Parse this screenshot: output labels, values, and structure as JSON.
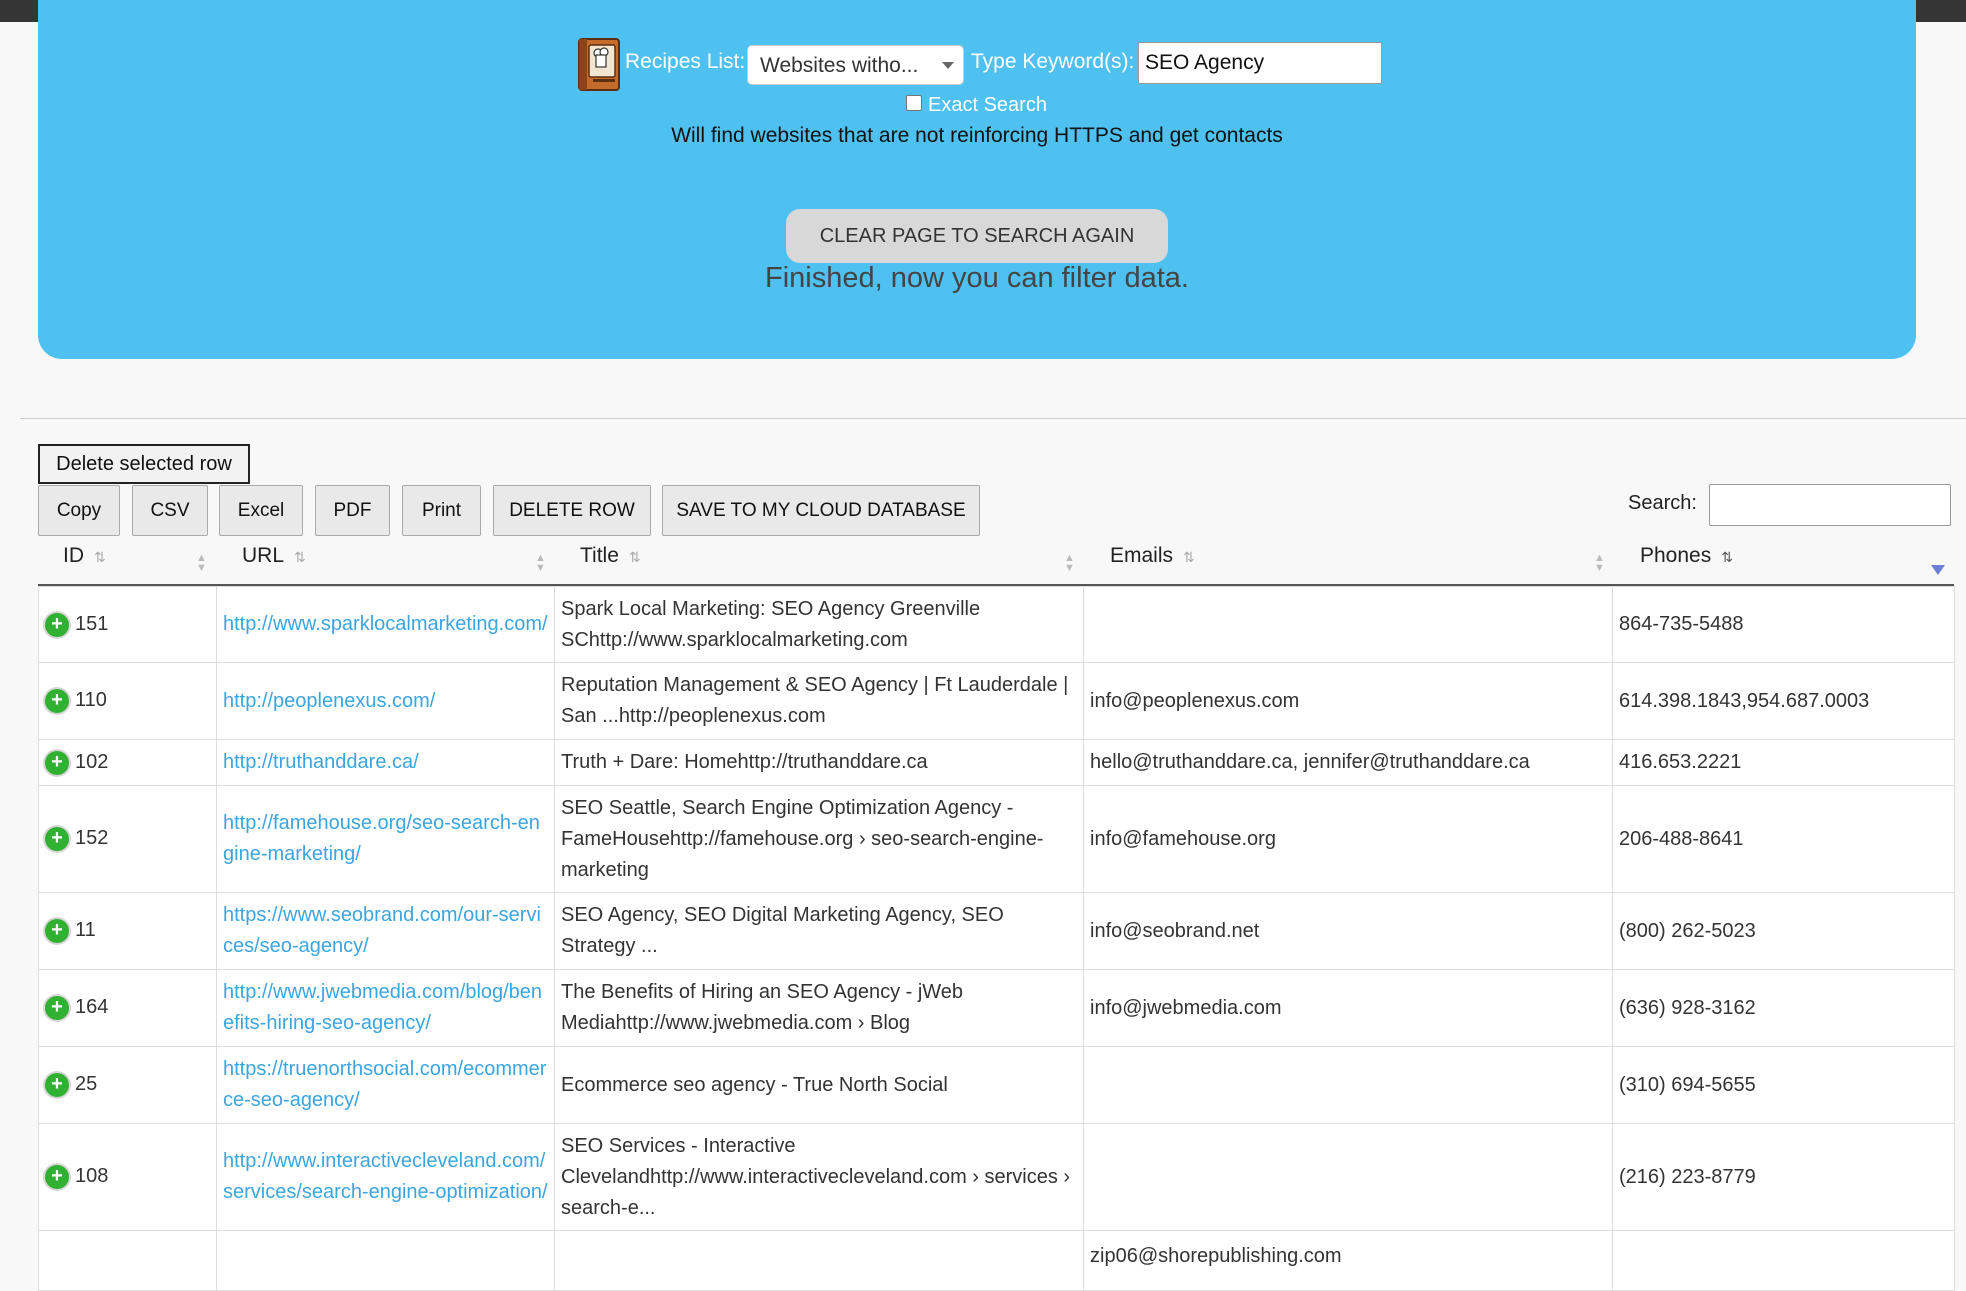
{
  "form": {
    "recipes_label": "Recipes List:",
    "recipe_selected": "Websites witho...",
    "keyword_label": "Type Keyword(s):",
    "keyword_value": "SEO Agency",
    "exact_search_label": "Exact Search",
    "description": "Will find websites that are not reinforcing HTTPS and get contacts",
    "clear_button": "CLEAR PAGE TO SEARCH AGAIN",
    "status": "Finished, now you can filter data."
  },
  "toolbar": {
    "delete_selected": "Delete selected row",
    "copy": "Copy",
    "csv": "CSV",
    "excel": "Excel",
    "pdf": "PDF",
    "print": "Print",
    "delete_row": "DELETE ROW",
    "save_cloud": "SAVE TO MY CLOUD DATABASE",
    "search_label": "Search:",
    "search_value": ""
  },
  "table": {
    "columns": [
      "ID",
      "URL",
      "Title",
      "Emails",
      "Phones"
    ],
    "rows": [
      {
        "id": "151",
        "url": "http://www.sparklocalmarketing.com/",
        "title": "Spark Local Marketing: SEO Agency Greenville SChttp://www.sparklocalmarketing.com",
        "emails": "",
        "phones": "864-735-5488"
      },
      {
        "id": "110",
        "url": "http://peoplenexus.com/",
        "title": "Reputation Management & SEO Agency | Ft Lauderdale | San ...http://peoplenexus.com",
        "emails": "info@peoplenexus.com",
        "phones": "614.398.1843,954.687.0003"
      },
      {
        "id": "102",
        "url": "http://truthanddare.ca/",
        "title": "Truth + Dare: Homehttp://truthanddare.ca",
        "emails": "hello@truthanddare.ca, jennifer@truthanddare.ca",
        "phones": "416.653.2221"
      },
      {
        "id": "152",
        "url": "http://famehouse.org/seo-search-engine-marketing/",
        "title": "SEO Seattle, Search Engine Optimization Agency - FameHousehttp://famehouse.org › seo-search-engine-marketing",
        "emails": "info@famehouse.org",
        "phones": "206-488-8641"
      },
      {
        "id": "11",
        "url": "https://www.seobrand.com/our-services/seo-agency/",
        "title": "SEO Agency, SEO Digital Marketing Agency, SEO Strategy ...",
        "emails": "info@seobrand.net",
        "phones": "(800) 262-5023"
      },
      {
        "id": "164",
        "url": "http://www.jwebmedia.com/blog/benefits-hiring-seo-agency/",
        "title": "The Benefits of Hiring an SEO Agency - jWeb Mediahttp://www.jwebmedia.com › Blog",
        "emails": "info@jwebmedia.com",
        "phones": "(636) 928-3162"
      },
      {
        "id": "25",
        "url": "https://truenorthsocial.com/ecommerce-seo-agency/",
        "title": "Ecommerce seo agency - True North Social",
        "emails": "",
        "phones": "(310) 694-5655"
      },
      {
        "id": "108",
        "url": "http://www.interactivecleveland.com/services/search-engine-optimization/",
        "title": "SEO Services - Interactive Clevelandhttp://www.interactivecleveland.com › services › search-e...",
        "emails": "",
        "phones": "(216) 223-8779"
      },
      {
        "id": "",
        "url": "",
        "title": "",
        "emails": "zip06@shorepublishing.com",
        "phones": ""
      }
    ]
  }
}
